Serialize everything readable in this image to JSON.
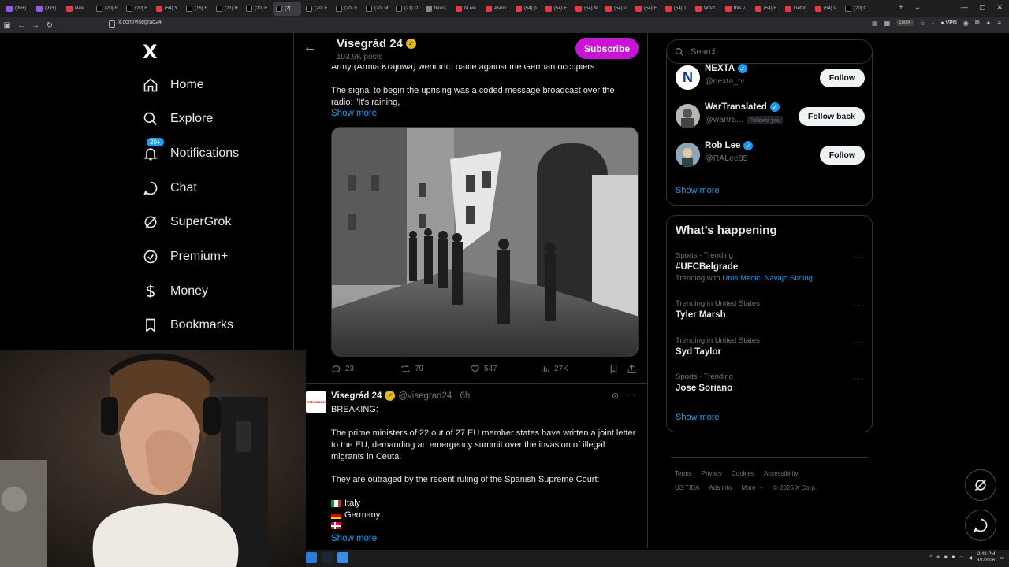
{
  "browser": {
    "tabs": [
      {
        "label": "(99+)",
        "fav": "purple"
      },
      {
        "label": "(99+)",
        "fav": "purple"
      },
      {
        "label": "New T",
        "fav": "red"
      },
      {
        "label": "(20) H",
        "fav": "x"
      },
      {
        "label": "(20) F",
        "fav": "x"
      },
      {
        "label": "(54) Y",
        "fav": "red"
      },
      {
        "label": "(16) E",
        "fav": "x"
      },
      {
        "label": "(21) H",
        "fav": "x"
      },
      {
        "label": "(20) F",
        "fav": "x"
      },
      {
        "label": "(2(",
        "fav": "x",
        "active": true
      },
      {
        "label": "(20) F",
        "fav": "x"
      },
      {
        "label": "(20) E",
        "fav": "x"
      },
      {
        "label": "(20) M",
        "fav": "x"
      },
      {
        "label": "(21) O",
        "fav": "x"
      },
      {
        "label": "beast",
        "fav": "grey"
      },
      {
        "label": "r/Live",
        "fav": "red"
      },
      {
        "label": "Asmo",
        "fav": "red"
      },
      {
        "label": "(54) p",
        "fav": "red"
      },
      {
        "label": "(54) F",
        "fav": "red"
      },
      {
        "label": "(54) N",
        "fav": "red"
      },
      {
        "label": "(54) u",
        "fav": "red"
      },
      {
        "label": "(54) E",
        "fav": "red"
      },
      {
        "label": "(54) T",
        "fav": "red"
      },
      {
        "label": "What",
        "fav": "red"
      },
      {
        "label": "this v",
        "fav": "red"
      },
      {
        "label": "(54) E",
        "fav": "red"
      },
      {
        "label": "Gettin",
        "fav": "red"
      },
      {
        "label": "(54) V",
        "fav": "red"
      },
      {
        "label": "(20) C",
        "fav": "x"
      }
    ],
    "url": "x.com/visegrad24",
    "zoom": "150%",
    "vpn_label": "VPN"
  },
  "nav": {
    "logo": "X",
    "items": [
      {
        "label": "Home",
        "icon": "home-icon"
      },
      {
        "label": "Explore",
        "icon": "search-icon"
      },
      {
        "label": "Notifications",
        "icon": "bell-icon",
        "badge": "20+"
      },
      {
        "label": "Chat",
        "icon": "chat-icon"
      },
      {
        "label": "SuperGrok",
        "icon": "grok-icon"
      },
      {
        "label": "Premium+",
        "icon": "premium-icon"
      },
      {
        "label": "Money",
        "icon": "money-icon"
      },
      {
        "label": "Bookmarks",
        "icon": "bookmark-icon"
      }
    ]
  },
  "profile": {
    "name": "Visegrád 24",
    "posts": "103.9K posts",
    "subscribe": "Subscribe"
  },
  "tweet1": {
    "line1": "Army (Armia Krajowa) went into battle against the German occupiers.",
    "line2": "The signal to begin the uprising was a coded message broadcast over the radio: \"It's raining,",
    "show_more": "Show more",
    "replies": "23",
    "reposts": "79",
    "likes": "547",
    "views": "27K"
  },
  "tweet2": {
    "avatar_text": "VISEGRAD24",
    "name": "Visegrád 24",
    "handle": "@visegrad24 · 6h",
    "breaking": "BREAKING:",
    "para1": "The prime ministers of 22 out of 27 EU member states have written a joint letter to the EU, demanding an emergency summit over the invasion of illegal migrants in Ceuta.",
    "para2": "They are outraged by the recent ruling of the Spanish Supreme Court:",
    "countries": [
      "Italy",
      "Germany",
      ""
    ],
    "show_more": "Show more"
  },
  "search": {
    "placeholder": "Search"
  },
  "who_to_follow": [
    {
      "name": "NEXTA",
      "handle": "@nexta_tv",
      "button": "Follow",
      "follows_you": ""
    },
    {
      "name": "WarTranslated",
      "handle": "@wartra...",
      "button": "Follow back",
      "follows_you": "Follows you"
    },
    {
      "name": "Rob Lee",
      "handle": "@RALee85",
      "button": "Follow",
      "follows_you": ""
    }
  ],
  "follow_show_more": "Show more",
  "happening": {
    "title": "What’s happening",
    "trends": [
      {
        "meta": "Sports · Trending",
        "name": "#UFCBelgrade",
        "with_label": "Trending with",
        "with_links": "Uros Medic, Navajo Stirling"
      },
      {
        "meta": "Trending in United States",
        "name": "Tyler Marsh"
      },
      {
        "meta": "Trending in United States",
        "name": "Syd Taylor"
      },
      {
        "meta": "Sports · Trending",
        "name": "Jose Soriano"
      }
    ],
    "show_more": "Show more"
  },
  "footer": {
    "row1": [
      "Terms",
      "Privacy",
      "Cookies",
      "Accessibility"
    ],
    "row2": [
      "US TIDA",
      "Ads info",
      "More ···",
      "© 2026 X Corp."
    ]
  },
  "taskbar": {
    "time": "2:43 PM",
    "date": "8/1/2026"
  },
  "colors": {
    "accent": "#1d9bf0",
    "subscribe": "#c913d6",
    "gold_check": "#e2b719"
  }
}
